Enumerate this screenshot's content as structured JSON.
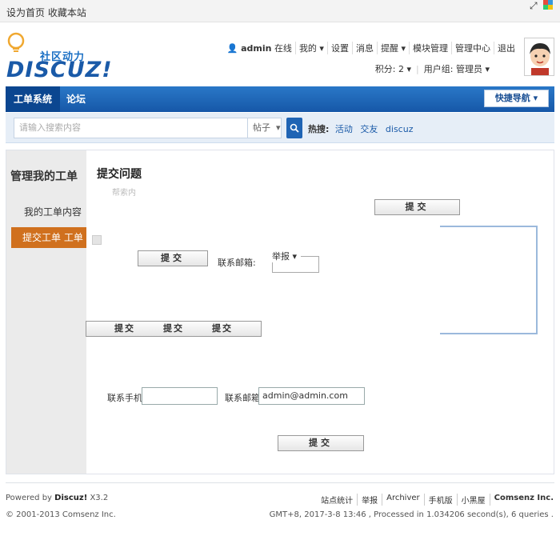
{
  "topbar": {
    "set_home": "设为首页",
    "bookmark": "收藏本站"
  },
  "logo": {
    "subtitle": "社区动力",
    "name": "DISCUZ!"
  },
  "user": {
    "username": "admin",
    "status": "在线",
    "links": [
      "我的",
      "设置",
      "消息",
      "提醒",
      "模块管理",
      "管理中心",
      "退出"
    ],
    "points": "积分: 2",
    "usergroup": "用户组: 管理员"
  },
  "nav": {
    "tabs": [
      "工单系统",
      "论坛"
    ],
    "quick_nav": "快捷导航"
  },
  "search": {
    "placeholder": "请输入搜索内容",
    "type": "帖子",
    "hot_label": "热搜:",
    "hot_tags": [
      "活动",
      "交友",
      "discuz"
    ]
  },
  "sidebar": {
    "title": "管理我的工单",
    "items": [
      "我的工单内容",
      "提交工单 工单"
    ]
  },
  "main": {
    "title": "提交问题",
    "ghost_text": "帮索内",
    "submit": "提交",
    "contact_email_label": "联系邮箱:",
    "report": "举报",
    "contact_phone_label": "联系手机:",
    "phone_value": "",
    "email_value": "admin@admin.com"
  },
  "footer": {
    "powered_prefix": "Powered by",
    "powered_product": "Discuz!",
    "powered_version": "X3.2",
    "copyright": "© 2001-2013 Comsenz Inc.",
    "links": [
      "站点统计",
      "举报",
      "Archiver",
      "手机版",
      "小黑屋"
    ],
    "company": "Comsenz Inc.",
    "stats": "GMT+8, 2017-3-8 13:46 , Processed in 1.034206 second(s), 6 queries ."
  }
}
